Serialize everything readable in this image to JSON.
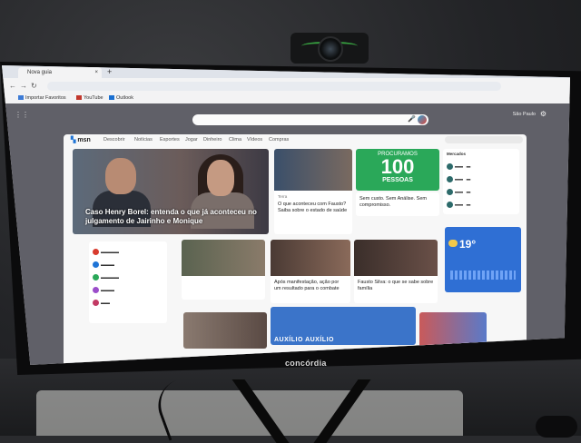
{
  "monitor": {
    "brand": "concórdia"
  },
  "browser": {
    "tab_title": "Nova guia",
    "tab_close": "×",
    "new_tab": "+",
    "bookmarks": [
      {
        "label": "Importar Favoritos",
        "icon": "import-icon"
      },
      {
        "label": "YouTube",
        "icon": "youtube-icon"
      },
      {
        "label": "Outlook",
        "icon": "outlook-icon"
      }
    ]
  },
  "newtab": {
    "user_label": "São Paulo",
    "search_placeholder": ""
  },
  "msn": {
    "logo": "msn",
    "nav": [
      "Descobrir",
      "Notícias",
      "Esportes",
      "Jogar",
      "Dinheiro",
      "Clima",
      "Vídeos",
      "Compras"
    ],
    "hero_title": "Caso Henry Borel: entenda o que já aconteceu no julgamento de Jairinho e Monique",
    "card1": {
      "source": "Terra",
      "title": "O que aconteceu com Fausto? Saiba sobre o estado de saúde"
    },
    "promo": {
      "line1": "PROCURAMOS",
      "number": "100",
      "line2": "PESSOAS"
    },
    "promo_caption": "Sem custo. Sem Análise. Sem compromisso.",
    "markets_title": "Mercados",
    "card2": {
      "title": "Após manifestação, ação por um resultado para o combate"
    },
    "card3": {
      "title": "Fausto Silva: o que se sabe sobre família"
    },
    "card4": {
      "title": ""
    },
    "weather": {
      "temp": "19°"
    },
    "banner_text": "AUXÍLIO AUXÍLIO"
  }
}
